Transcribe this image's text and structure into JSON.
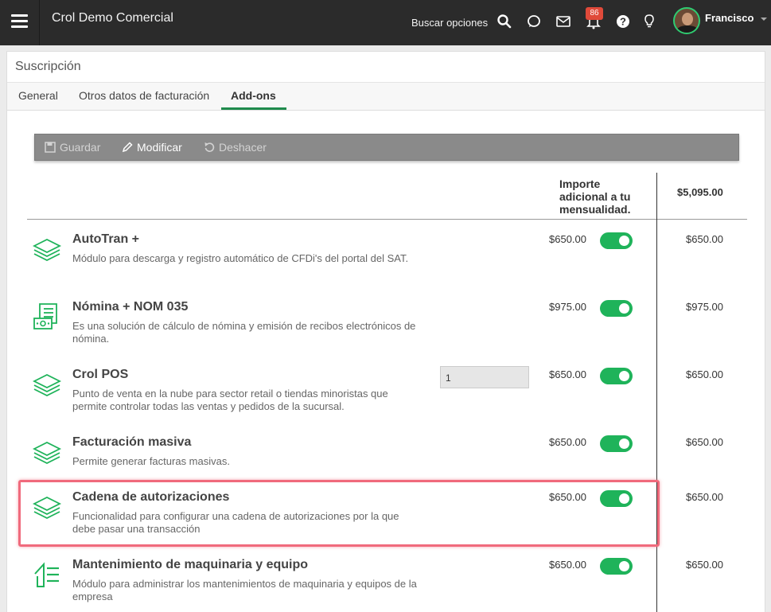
{
  "topbar": {
    "app_title": "Crol Demo Comercial",
    "search_label": "Buscar opciones",
    "notification_count": "86",
    "user_name": "Francisco"
  },
  "page": {
    "title": "Suscripción",
    "tabs": [
      {
        "label": "General",
        "active": false
      },
      {
        "label": "Otros datos de facturación",
        "active": false
      },
      {
        "label": "Add-ons",
        "active": true
      }
    ]
  },
  "toolbar": {
    "save_label": "Guardar",
    "edit_label": "Modificar",
    "undo_label": "Deshacer"
  },
  "table": {
    "header_additional": "Importe adicional a tu mensualidad.",
    "header_total": "$5,095.00",
    "rows": [
      {
        "icon": "layers-icon",
        "name": "AutoTran +",
        "description": "Módulo para descarga y registro automático de CFDi's del portal del SAT.",
        "price": "$650.00",
        "enabled": true,
        "total": "$650.00"
      },
      {
        "icon": "payroll-icon",
        "name": "Nómina + NOM 035",
        "description": "Es una solución de cálculo de nómina y emisión de recibos electrónicos de nómina.",
        "price": "$975.00",
        "enabled": true,
        "total": "$975.00"
      },
      {
        "icon": "layers-icon",
        "name": "Crol POS",
        "description": "Punto de venta en la nube para sector retail o tiendas minoristas que permite controlar todas las ventas y pedidos de la sucursal.",
        "quantity": "1",
        "price": "$650.00",
        "enabled": true,
        "total": "$650.00"
      },
      {
        "icon": "layers-icon",
        "name": "Facturación masiva",
        "description": "Permite generar facturas masivas.",
        "price": "$650.00",
        "enabled": true,
        "total": "$650.00"
      },
      {
        "icon": "layers-icon",
        "name": "Cadena de autorizaciones",
        "description": "Funcionalidad para configurar una cadena de autorizaciones por la que debe pasar una transacción",
        "price": "$650.00",
        "enabled": true,
        "total": "$650.00"
      },
      {
        "icon": "maintenance-icon",
        "name": "Mantenimiento de maquinaria y equipo",
        "description": "Módulo para administrar los mantenimientos de maquinaria y equipos de la empresa",
        "price": "$650.00",
        "enabled": true,
        "total": "$650.00"
      }
    ]
  },
  "colors": {
    "accent_green": "#1fb35a",
    "topbar": "#2b2b2b",
    "highlight": "#f06a7c"
  }
}
